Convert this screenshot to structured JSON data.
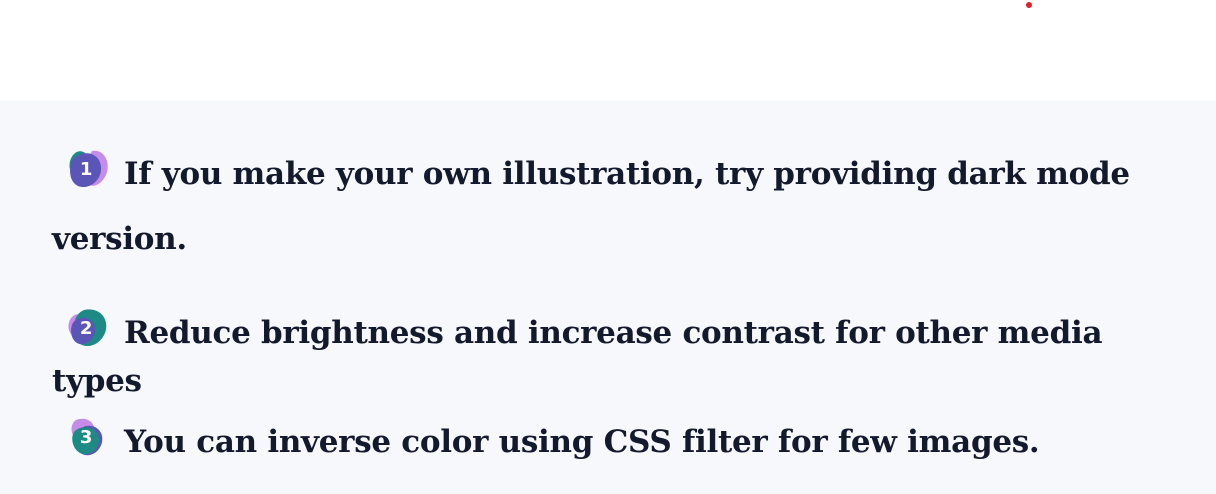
{
  "colors": {
    "page_background": "#ffffff",
    "list_background": "#f7f8fb",
    "text": "#141a2e",
    "badge_purple": "#5b55b8",
    "badge_teal": "#1e8a85",
    "badge_lilac": "#c58ce8",
    "indicator_dot": "#e0202a"
  },
  "tips": [
    {
      "number": "1",
      "text": "If you make your own illustration, try providing dark mode version."
    },
    {
      "number": "2",
      "text": "Reduce brightness and increase contrast for other media types"
    },
    {
      "number": "3",
      "text": "You can inverse color using CSS filter for few images."
    }
  ]
}
